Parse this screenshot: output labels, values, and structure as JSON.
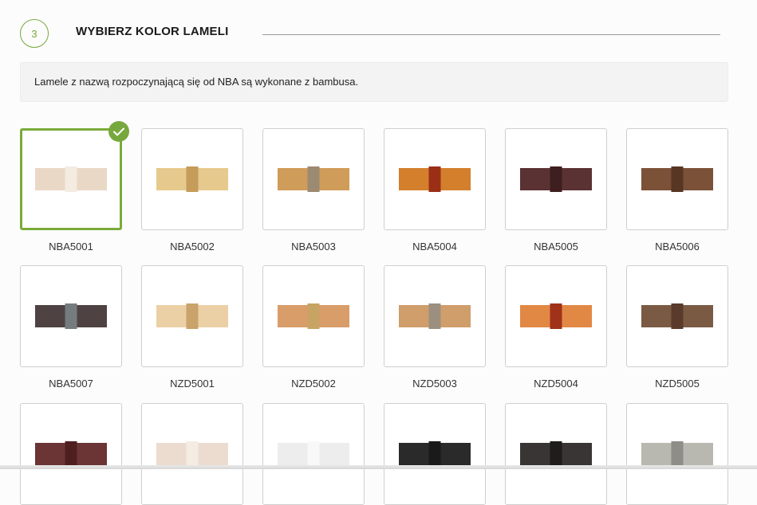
{
  "step": {
    "number": "3",
    "title": "WYBIERZ KOLOR LAMELI"
  },
  "info": "Lamele z nazwą rozpoczynającą się od NBA są wykonane z bambusa.",
  "selected_icon": "check-icon",
  "colors": {
    "accent": "#77a83d"
  },
  "swatches": [
    {
      "code": "NBA5001",
      "slat": "#ead8c7",
      "clip": "#f4ebe1",
      "selected": true
    },
    {
      "code": "NBA5002",
      "slat": "#e6c98d",
      "clip": "#c59c5a",
      "selected": false
    },
    {
      "code": "NBA5003",
      "slat": "#d09c5a",
      "clip": "#9c8a72",
      "selected": false
    },
    {
      "code": "NBA5004",
      "slat": "#d37f2c",
      "clip": "#9b2f16",
      "selected": false
    },
    {
      "code": "NBA5005",
      "slat": "#5b3233",
      "clip": "#3e1e1e",
      "selected": false
    },
    {
      "code": "NBA5006",
      "slat": "#7b5138",
      "clip": "#573624",
      "selected": false
    },
    {
      "code": "NBA5007",
      "slat": "#4f4242",
      "clip": "#757c7f",
      "selected": false
    },
    {
      "code": "NZD5001",
      "slat": "#ecd0a5",
      "clip": "#c9a36b",
      "selected": false
    },
    {
      "code": "NZD5002",
      "slat": "#d99d69",
      "clip": "#c7a463",
      "selected": false
    },
    {
      "code": "NZD5003",
      "slat": "#cf9e6a",
      "clip": "#9d8f7f",
      "selected": false
    },
    {
      "code": "NZD5004",
      "slat": "#e28845",
      "clip": "#9f3218",
      "selected": false
    },
    {
      "code": "NZD5005",
      "slat": "#7b5a43",
      "clip": "#5a3b2b",
      "selected": false
    },
    {
      "code": "",
      "slat": "#6b3535",
      "clip": "#4f1f1f",
      "selected": false
    },
    {
      "code": "",
      "slat": "#ecdcd0",
      "clip": "#f5ece4",
      "selected": false
    },
    {
      "code": "",
      "slat": "#ededed",
      "clip": "#f8f8f8",
      "selected": false
    },
    {
      "code": "",
      "slat": "#2a2a2a",
      "clip": "#1a1a1a",
      "selected": false
    },
    {
      "code": "",
      "slat": "#3a3535",
      "clip": "#1f1c1c",
      "selected": false
    },
    {
      "code": "",
      "slat": "#b9b8b0",
      "clip": "#8e8d88",
      "selected": false
    }
  ]
}
